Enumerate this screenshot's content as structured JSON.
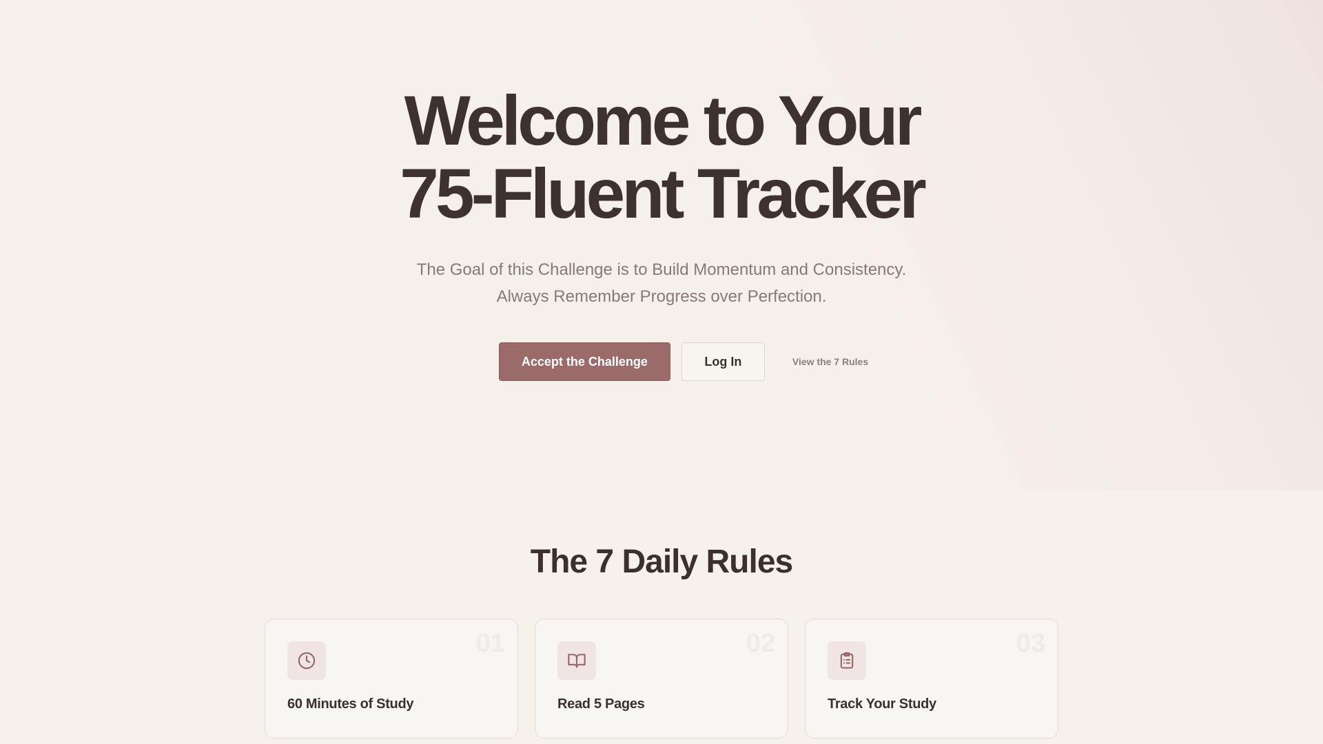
{
  "hero": {
    "title_line1": "Welcome to Your",
    "title_line2": "75-Fluent Tracker",
    "subtitle_line1": "The Goal of this Challenge is to Build Momentum and Consistency.",
    "subtitle_line2": "Always Remember Progress over Perfection.",
    "primary_button": "Accept the Challenge",
    "secondary_button": "Log In",
    "link": "View the 7 Rules"
  },
  "rules": {
    "title": "The 7 Daily Rules",
    "cards": [
      {
        "number": "01",
        "icon": "clock-icon",
        "title": "60 Minutes of Study"
      },
      {
        "number": "02",
        "icon": "open-book-icon",
        "title": "Read 5 Pages"
      },
      {
        "number": "03",
        "icon": "clipboard-list-icon",
        "title": "Track Your Study"
      }
    ]
  },
  "colors": {
    "background": "#f6f1eb",
    "accent": "#9b6b69",
    "heading": "#3d3230",
    "muted_text": "#857a76",
    "icon_tile": "#f0e5e2"
  }
}
